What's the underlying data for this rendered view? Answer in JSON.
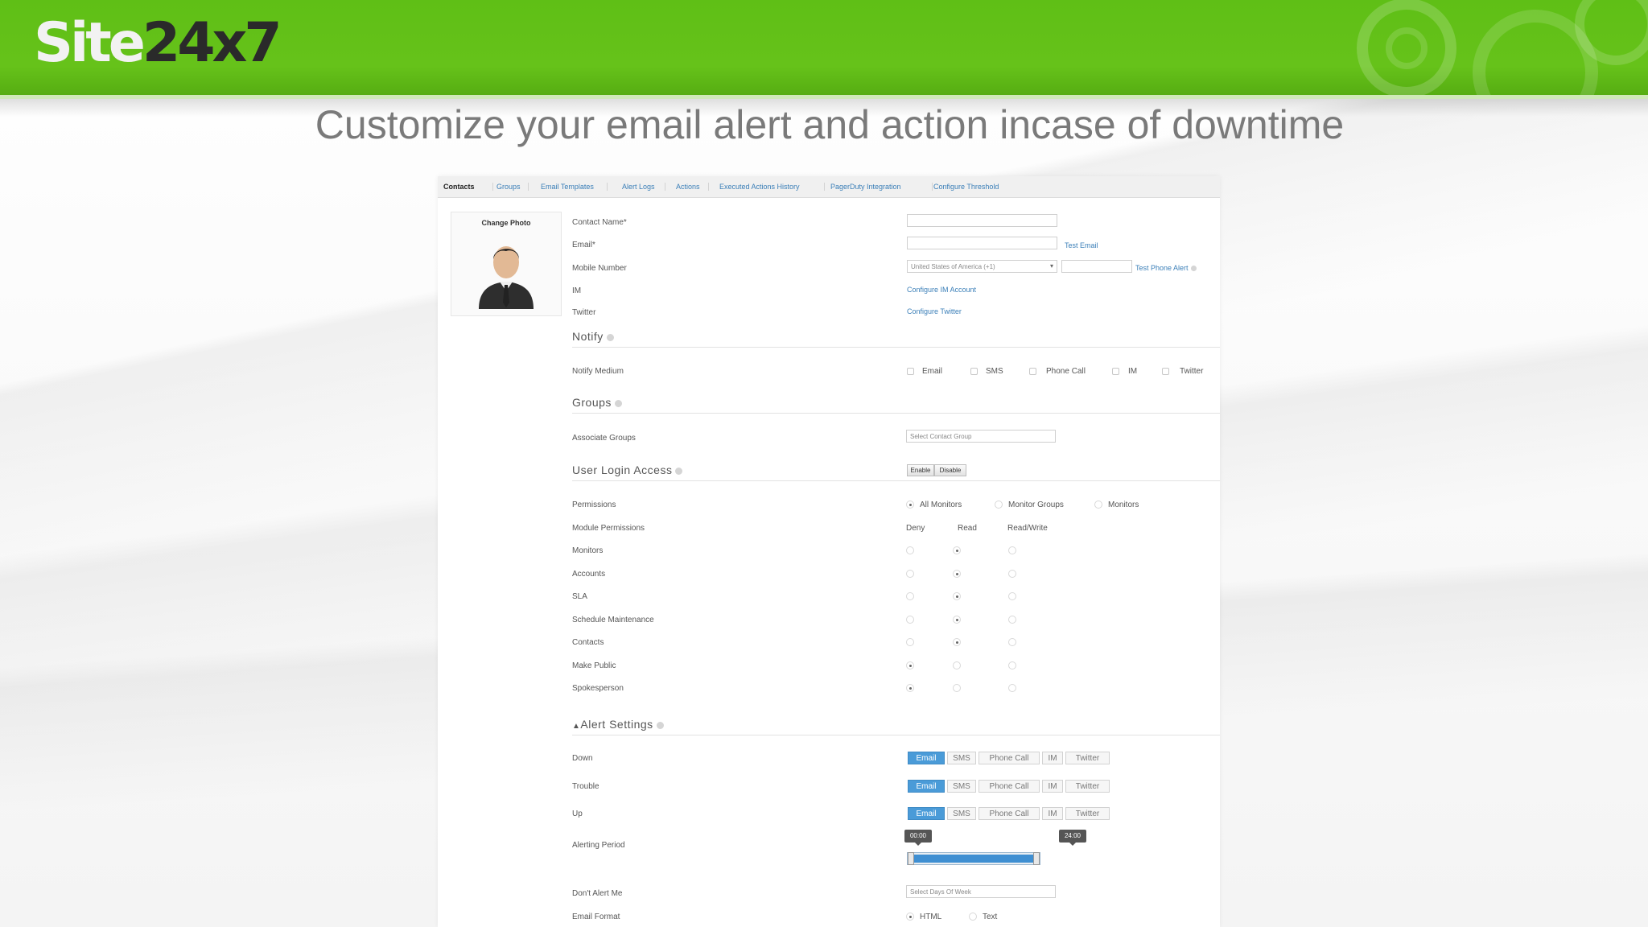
{
  "brand": {
    "logo_part1": "Site",
    "logo_part2": "24x7"
  },
  "slide_title": "Customize your email alert and action incase of downtime",
  "tabs": [
    {
      "label": "Contacts",
      "active": true
    },
    {
      "label": "Groups"
    },
    {
      "label": "Email Templates"
    },
    {
      "label": "Alert Logs"
    },
    {
      "label": "Actions"
    },
    {
      "label": "Executed Actions History"
    },
    {
      "label": "PagerDuty Integration"
    },
    {
      "label": "Configure Threshold"
    }
  ],
  "photo": {
    "label": "Change Photo"
  },
  "contact": {
    "name_label": "Contact Name*",
    "email_label": "Email*",
    "test_email": "Test Email",
    "mobile_label": "Mobile Number",
    "country_value": "United States of America (+1)",
    "test_phone": "Test Phone Alert",
    "im_label": "IM",
    "configure_im": "Configure IM Account",
    "twitter_label": "Twitter",
    "configure_twitter": "Configure Twitter"
  },
  "notify": {
    "title": "Notify",
    "medium_label": "Notify Medium",
    "options": [
      "Email",
      "SMS",
      "Phone Call",
      "IM",
      "Twitter"
    ]
  },
  "groups": {
    "title": "Groups",
    "associate_label": "Associate Groups",
    "placeholder": "Select Contact Group"
  },
  "login": {
    "title": "User Login Access",
    "enable": "Enable",
    "disable": "Disable",
    "permissions_label": "Permissions",
    "permission_options": [
      "All Monitors",
      "Monitor Groups",
      "Monitors"
    ],
    "module_label": "Module Permissions",
    "columns": [
      "Deny",
      "Read",
      "Read/Write"
    ],
    "modules": [
      {
        "name": "Monitors",
        "selected": 1
      },
      {
        "name": "Accounts",
        "selected": 1
      },
      {
        "name": "SLA",
        "selected": 1
      },
      {
        "name": "Schedule Maintenance",
        "selected": 1
      },
      {
        "name": "Contacts",
        "selected": 1
      },
      {
        "name": "Make Public",
        "selected": 0
      },
      {
        "name": "Spokesperson",
        "selected": 0
      }
    ]
  },
  "alerts": {
    "title": "Alert Settings",
    "toggle_glyph": "▲",
    "channels": [
      "Email",
      "SMS",
      "Phone Call",
      "IM",
      "Twitter"
    ],
    "rows": [
      {
        "label": "Down"
      },
      {
        "label": "Trouble"
      },
      {
        "label": "Up"
      }
    ],
    "period_label": "Alerting Period",
    "period_start": "00:00",
    "period_end": "24:00",
    "dont_alert_label": "Don't Alert Me",
    "dont_alert_placeholder": "Select Days Of Week",
    "format_label": "Email Format",
    "format_options": [
      "HTML",
      "Text"
    ]
  },
  "colors": {
    "header_green": "#66c21a",
    "accent_blue": "#4a9bd8",
    "link_blue": "#3b7fb8"
  }
}
